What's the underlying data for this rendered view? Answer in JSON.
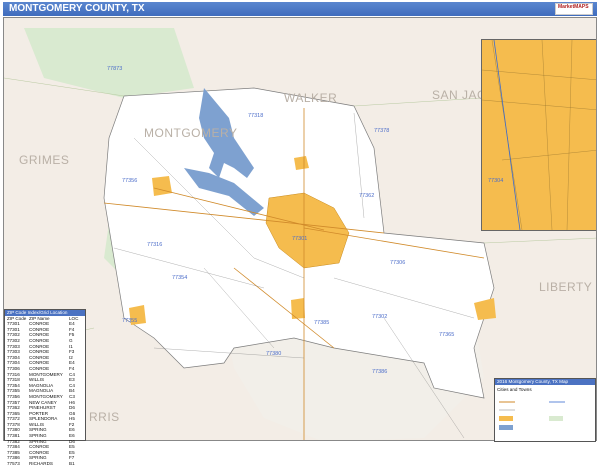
{
  "title": "MONTGOMERY COUNTY, TX",
  "logo_text": "MarketMAPS",
  "counties": [
    {
      "key": "walker",
      "name": "WALKER"
    },
    {
      "key": "san_jacinto",
      "name": "SAN JAC"
    },
    {
      "key": "grimes",
      "name": "GRIMES"
    },
    {
      "key": "montgomery",
      "name": "MONTGOMERY"
    },
    {
      "key": "liberty",
      "name": "LIBERTY"
    },
    {
      "key": "harris",
      "name": "RRIS"
    }
  ],
  "zip_labels": [
    "77873",
    "77318",
    "77378",
    "77356",
    "77362",
    "77316",
    "77301",
    "77306",
    "77354",
    "77355",
    "77385",
    "77302",
    "77365",
    "77380",
    "77386",
    "77304"
  ],
  "zip_index": {
    "header": "ZIP Code Index/Grid Location",
    "col_headers": [
      "ZIP Code",
      "ZIP Name",
      "LOC"
    ],
    "rows": [
      [
        "77301",
        "CONROE",
        "E4"
      ],
      [
        "77301",
        "CONROE",
        "F4"
      ],
      [
        "77302",
        "CONROE",
        "F5"
      ],
      [
        "77302",
        "CONROE",
        "G"
      ],
      [
        "77303",
        "CONROE",
        "I1"
      ],
      [
        "77303",
        "CONROE",
        "F3"
      ],
      [
        "77304",
        "CONROE",
        "I2"
      ],
      [
        "77304",
        "CONROE",
        "E4"
      ],
      [
        "77306",
        "CONROE",
        "F4"
      ],
      [
        "77316",
        "MONTGOMERY",
        "C4"
      ],
      [
        "77318",
        "WILLIS",
        "E3"
      ],
      [
        "77354",
        "MAGNOLIA",
        "C4"
      ],
      [
        "77355",
        "MAGNOLIA",
        "B4"
      ],
      [
        "77356",
        "MONTGOMERY",
        "C3"
      ],
      [
        "77357",
        "NEW CANEY",
        "H6"
      ],
      [
        "77362",
        "PINEHURST",
        "D6"
      ],
      [
        "77365",
        "PORTER",
        "G6"
      ],
      [
        "77372",
        "SPLENDORA",
        "H5"
      ],
      [
        "77378",
        "WILLIS",
        "F2"
      ],
      [
        "77380",
        "SPRING",
        "E6"
      ],
      [
        "77381",
        "SPRING",
        "E6"
      ],
      [
        "77382",
        "SPRING",
        "D6"
      ],
      [
        "77384",
        "CONROE",
        "E5"
      ],
      [
        "77385",
        "CONROE",
        "E5"
      ],
      [
        "77386",
        "SPRING",
        "F7"
      ],
      [
        "77573",
        "RICHARDS",
        "B1"
      ]
    ]
  },
  "legend": {
    "header": "2016 Montgomery County, TX Map",
    "title_rows": [
      "Cities and Towns"
    ]
  }
}
